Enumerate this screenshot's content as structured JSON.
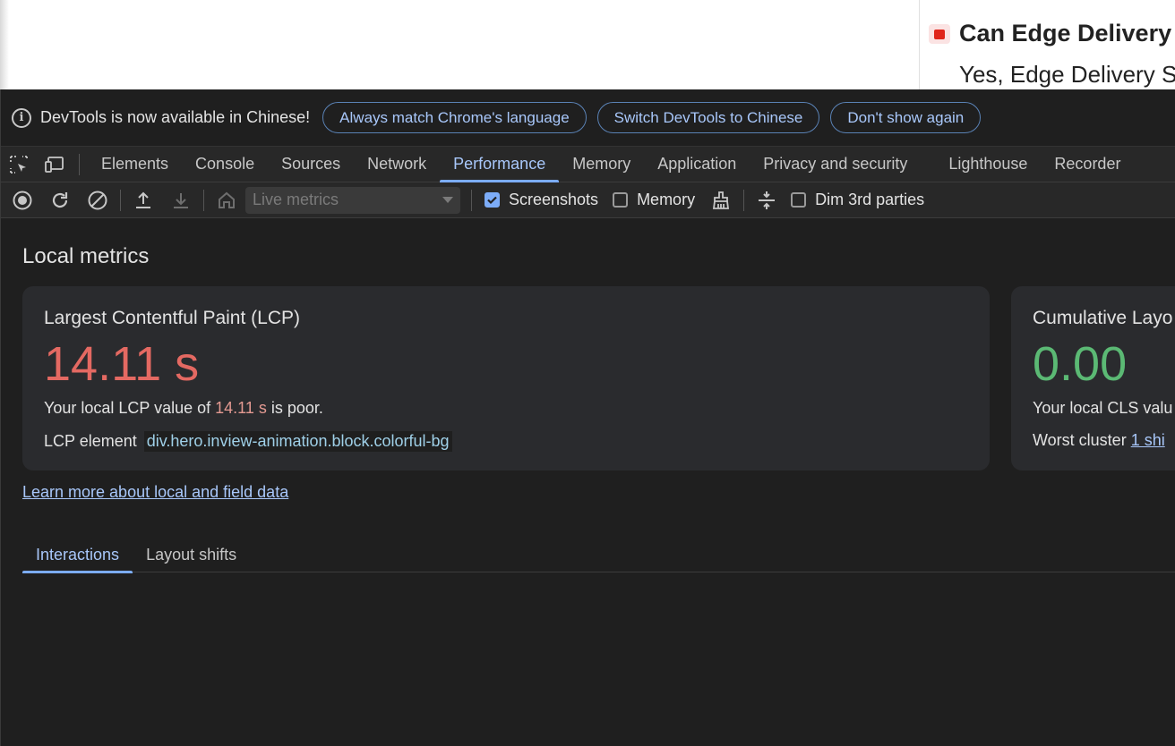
{
  "webpage": {
    "faq_title": "Can Edge Delivery S",
    "faq_answer": "Yes, Edge Delivery S"
  },
  "infobar": {
    "message": "DevTools is now available in Chinese!",
    "buttons": [
      "Always match Chrome's language",
      "Switch DevTools to Chinese",
      "Don't show again"
    ]
  },
  "tabs": [
    "Elements",
    "Console",
    "Sources",
    "Network",
    "Performance",
    "Memory",
    "Application",
    "Privacy and security",
    "Lighthouse",
    "Recorder"
  ],
  "active_tab": "Performance",
  "toolbar": {
    "select_value": "Live metrics",
    "screenshots_label": "Screenshots",
    "memory_label": "Memory",
    "dim_label": "Dim 3rd parties"
  },
  "main": {
    "section_title": "Local metrics",
    "lcp": {
      "title": "Largest Contentful Paint (LCP)",
      "value": "14.11 s",
      "desc_prefix": "Your local LCP value of ",
      "desc_value": "14.11 s",
      "desc_suffix": " is poor.",
      "element_label": "LCP element",
      "element_node": "div.hero.inview-animation.block.colorful-bg"
    },
    "cls": {
      "title": "Cumulative Layo",
      "value": "0.00",
      "desc": "Your local CLS valu",
      "cluster_label": "Worst cluster ",
      "cluster_link": "1 shi"
    },
    "learn_link": "Learn more about local and field data",
    "subtabs": [
      "Interactions",
      "Layout shifts"
    ]
  },
  "colors": {
    "poor": "#e46962",
    "good": "#5bb974",
    "accent": "#a8c7fa"
  }
}
